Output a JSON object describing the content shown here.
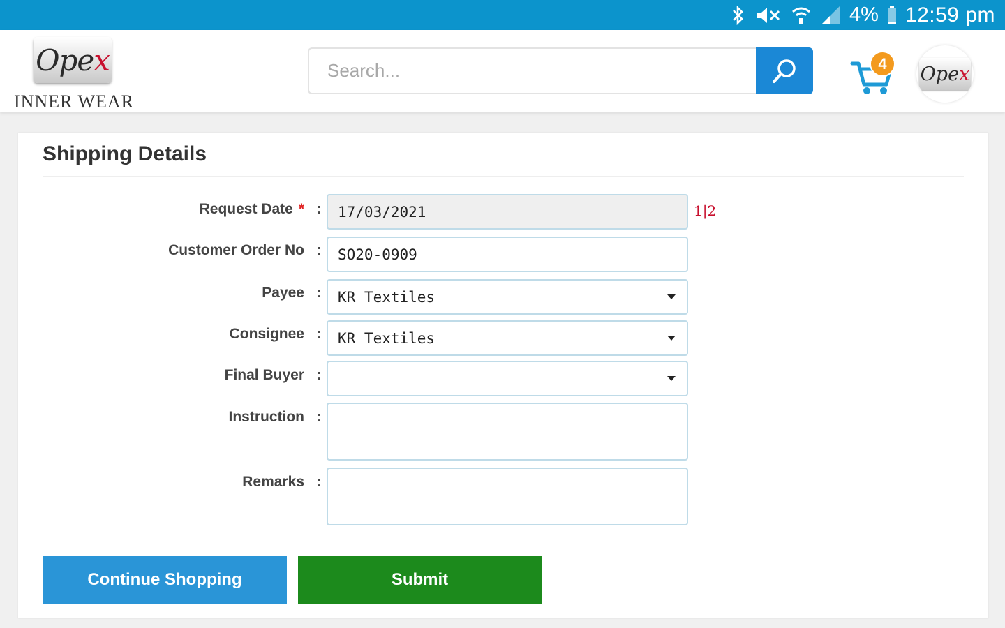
{
  "status_bar": {
    "battery": "4%",
    "time": "12:59 pm"
  },
  "header": {
    "logo_text_main": "Ope",
    "logo_text_accent": "x",
    "logo_subtitle": "INNER WEAR",
    "search_placeholder": "Search...",
    "cart_count": "4",
    "avatar_text_main": "Ope",
    "avatar_text_accent": "x"
  },
  "form": {
    "title": "Shipping Details",
    "fields": {
      "request_date": {
        "label": "Request Date",
        "required_mark": "*",
        "value": "17/03/2021"
      },
      "customer_order_no": {
        "label": "Customer Order No",
        "value": "SO20-0909"
      },
      "payee": {
        "label": "Payee",
        "value": "KR Textiles"
      },
      "consignee": {
        "label": "Consignee",
        "value": "KR Textiles"
      },
      "final_buyer": {
        "label": "Final Buyer",
        "value": ""
      },
      "instruction": {
        "label": "Instruction",
        "value": ""
      },
      "remarks": {
        "label": "Remarks",
        "value": ""
      }
    },
    "colon": ":",
    "calendar_glyph": "1|2"
  },
  "actions": {
    "continue_label": "Continue Shopping",
    "submit_label": "Submit"
  },
  "colors": {
    "status_bar": "#0c94cc",
    "search_button": "#1b88d6",
    "continue_button": "#2a95d7",
    "submit_button": "#1c8a1c",
    "cart_badge": "#f39a1e"
  }
}
